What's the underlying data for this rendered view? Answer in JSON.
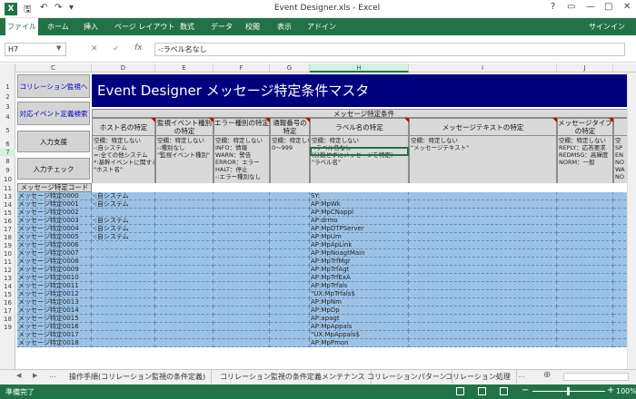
{
  "window": {
    "title": "Event Designer.xls - Excel",
    "app_icon": "X",
    "qa_save": "🖫",
    "qa_undo": "↶",
    "qa_redo": "↷",
    "qa_more": "▾",
    "help": "?",
    "restore": "▭",
    "minimize": "—",
    "maximize": "□",
    "close": "✕"
  },
  "ribbon": {
    "tabs": [
      "ファイル",
      "ホーム",
      "挿入",
      "ページ レイアウト",
      "数式",
      "データ",
      "校閲",
      "表示",
      "アドイン"
    ],
    "signin": "サインイン"
  },
  "formula_bar": {
    "name_box": "H7",
    "cancel": "✕",
    "enter": "✓",
    "fx": "fx",
    "value": "-:ラベル名なし"
  },
  "columns": [
    "C",
    "D",
    "E",
    "F",
    "G",
    "H",
    "I",
    "J"
  ],
  "selected_column": "H",
  "rows": [
    "1",
    "2",
    "3",
    "4",
    "5",
    "6",
    "7",
    "8",
    "9",
    "10",
    "11",
    "13",
    "14",
    "15",
    "16",
    "17",
    "18",
    "19",
    "10",
    "11",
    "12",
    "13",
    "14",
    "15",
    "16",
    "17",
    "18",
    "19"
  ],
  "sheet": {
    "banner": "Event Designer メッセージ特定条件マスタ",
    "btn_correlation": "コリレーション監視へ",
    "btn_search": "対応イベント定義検索",
    "btn_input_support": "入力支援",
    "btn_input_check": "入力チェック",
    "group_header": "メッセージ特定条件",
    "col_code": "メッセージ特定コード",
    "headers": [
      "ホスト名の特定",
      "監視イベント種別の特定",
      "エラー種別の特定",
      "通報番号の特定",
      "ラベル名の特定",
      "メッセージテキストの特定",
      "メッセージタイプの特定"
    ],
    "desc": [
      "空欄：特定しない\n-:自システム\n=:全ての他システム\n*:基幹イベントに関するホスト\n\"ホスト名\"",
      "空欄：特定しない\n-:種別なし\n\"監視イベント種別\"",
      "空欄：特定しない\nINFO：情報\nWARN：警告\nERROR：エラー\nHALT：停止\n-:エラー種別なし",
      "空欄：特定しない\n0～999",
      "空欄：特定しない\n-:ラベル名なし\n(分割せずにメッセージを特定)\n\"ラベル名\"",
      "空欄：特定しない\n\"メッセージテキスト\"",
      "空欄：特定しない\nREPLY：応答要求\nREDMSG：高輝度\nNORM：一般"
    ],
    "partial_col": [
      "空",
      "SP",
      "EN",
      "NO",
      "WA",
      "NO"
    ],
    "data_rows": [
      {
        "code": "メッセージ特定0000",
        "host": "-:自システム",
        "label": "SY:"
      },
      {
        "code": "メッセージ特定0001",
        "host": "-:自システム",
        "label": "AP:MpWk"
      },
      {
        "code": "メッセージ特定0002",
        "host": "",
        "label": "AP:MpCNappl"
      },
      {
        "code": "メッセージ特定0003",
        "host": "-:自システム",
        "label": "AP:drmo"
      },
      {
        "code": "メッセージ特定0004",
        "host": "-:自システム",
        "label": "AP:MpDTPServer"
      },
      {
        "code": "メッセージ特定0005",
        "host": "-:自システム",
        "label": "AP:MpUm"
      },
      {
        "code": "メッセージ特定0006",
        "host": "",
        "label": "AP:MpApLink"
      },
      {
        "code": "メッセージ特定0007",
        "host": "",
        "label": "AP:MpNoagtMain"
      },
      {
        "code": "メッセージ特定0008",
        "host": "",
        "label": "AP:MpTrfMgr"
      },
      {
        "code": "メッセージ特定0009",
        "host": "",
        "label": "AP:MpTrfAgt"
      },
      {
        "code": "メッセージ特定0010",
        "host": "",
        "label": "AP:MpTrfExA"
      },
      {
        "code": "メッセージ特定0011",
        "host": "",
        "label": "AP:MpTrfals"
      },
      {
        "code": "メッセージ特定0012",
        "host": "",
        "label": "\"UX:MpTrfals$"
      },
      {
        "code": "メッセージ特定0013",
        "host": "",
        "label": "AP:MpNm"
      },
      {
        "code": "メッセージ特定0014",
        "host": "",
        "label": "AP:MpDp"
      },
      {
        "code": "メッセージ特定0015",
        "host": "",
        "label": "AP:apagt"
      },
      {
        "code": "メッセージ特定0016",
        "host": "",
        "label": "AP:MpAppals"
      },
      {
        "code": "メッセージ特定0017",
        "host": "",
        "label": "\"UX:MpAppals$"
      },
      {
        "code": "メッセージ特定0018",
        "host": "",
        "label": "AP:MpPmon"
      }
    ]
  },
  "sheet_tabs": {
    "nav": [
      "◀",
      "▶",
      "..."
    ],
    "tabs": [
      "操作手順(コリレーション監視の条件定義)",
      "コリレーション監視の条件定義メンテナンス",
      "コリレーションパターン",
      "コリレーション処理"
    ],
    "more": "...",
    "add": "⊕"
  },
  "status": {
    "ready": "準備完了",
    "zoom": "100%",
    "minus": "−",
    "plus": "+"
  }
}
